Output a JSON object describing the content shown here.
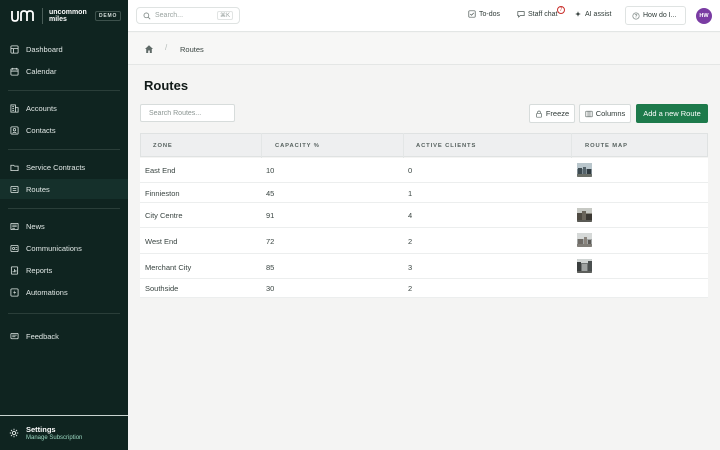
{
  "brand": {
    "name_line1": "uncommon",
    "name_line2": "miles",
    "badge": "DEMO"
  },
  "sidebar": {
    "items": [
      {
        "label": "Dashboard",
        "icon": "dashboard-icon"
      },
      {
        "label": "Calendar",
        "icon": "calendar-icon"
      },
      {
        "label": "Accounts",
        "icon": "building-icon"
      },
      {
        "label": "Contacts",
        "icon": "contact-icon"
      },
      {
        "label": "Service Contracts",
        "icon": "folder-icon"
      },
      {
        "label": "Routes",
        "icon": "routes-icon",
        "active": true
      },
      {
        "label": "News",
        "icon": "news-icon"
      },
      {
        "label": "Communications",
        "icon": "communications-icon"
      },
      {
        "label": "Reports",
        "icon": "reports-icon"
      },
      {
        "label": "Automations",
        "icon": "automations-icon"
      },
      {
        "label": "Feedback",
        "icon": "feedback-icon"
      }
    ],
    "settings": {
      "title": "Settings",
      "subtitle": "Manage Subscription"
    }
  },
  "topbar": {
    "search_placeholder": "Search...",
    "search_shortcut": "⌘K",
    "todos": "To-dos",
    "staff_chat": "Staff chat",
    "staff_chat_count": "7",
    "ai_assist": "AI assist",
    "help": "How do I...",
    "avatar_initials": "HW"
  },
  "breadcrumb": {
    "sep": "/",
    "current": "Routes"
  },
  "page": {
    "title": "Routes",
    "search_placeholder": "Search Routes...",
    "freeze": "Freeze",
    "columns": "Columns",
    "add": "Add a new Route"
  },
  "table": {
    "headers": [
      "ZONE",
      "CAPACITY %",
      "ACTIVE CLIENTS",
      "ROUTE MAP"
    ],
    "rows": [
      {
        "zone": "East End",
        "capacity": "10",
        "clients": "0",
        "map": true
      },
      {
        "zone": "Finnieston",
        "capacity": "45",
        "clients": "1",
        "map": false
      },
      {
        "zone": "City Centre",
        "capacity": "91",
        "clients": "4",
        "map": true
      },
      {
        "zone": "West End",
        "capacity": "72",
        "clients": "2",
        "map": true
      },
      {
        "zone": "Merchant City",
        "capacity": "85",
        "clients": "3",
        "map": true
      },
      {
        "zone": "Southside",
        "capacity": "30",
        "clients": "2",
        "map": false
      }
    ]
  },
  "colors": {
    "sidebar_bg": "#0f2420",
    "primary": "#1d7a4b",
    "avatar": "#7a3ca3",
    "badge_red": "#c9302c"
  }
}
